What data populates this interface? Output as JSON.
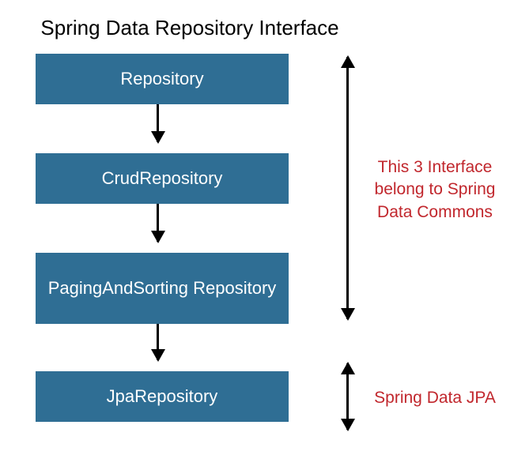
{
  "title": "Spring Data Repository Interface",
  "boxes": {
    "b1": "Repository",
    "b2": "CrudRepository",
    "b3": "PagingAndSorting Repository",
    "b4": "JpaRepository"
  },
  "annotations": {
    "a1": "This 3 Interface belong to Spring Data Commons",
    "a2": "Spring Data JPA"
  },
  "colors": {
    "box_bg": "#2f6e94",
    "annotation": "#c1272d"
  }
}
